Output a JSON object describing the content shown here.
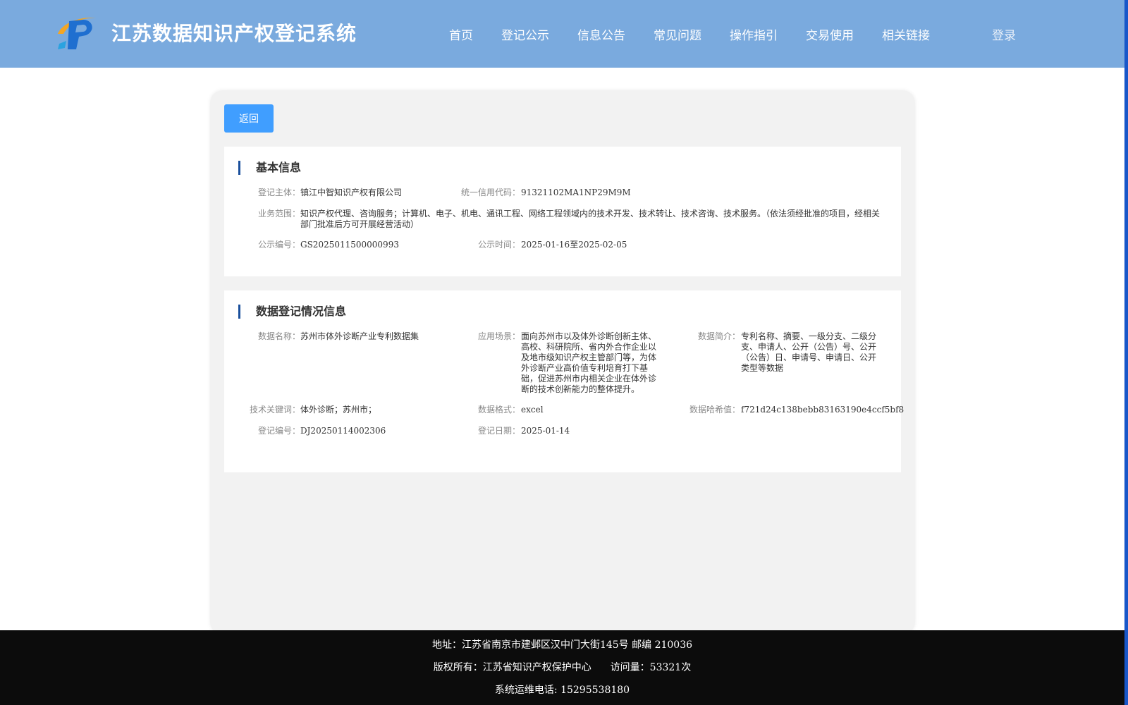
{
  "header": {
    "title": "江苏数据知识产权登记系统",
    "nav": [
      "首页",
      "登记公示",
      "信息公告",
      "常见问题",
      "操作指引",
      "交易使用",
      "相关链接"
    ],
    "login": "登录"
  },
  "back_button": "返回",
  "basic_info": {
    "title": "基本信息",
    "subject_label": "登记主体：",
    "subject": "镇江中智知识产权有限公司",
    "credit_code_label": "统一信用代码：",
    "credit_code": "91321102MA1NP29M9M",
    "business_scope_label": "业务范围：",
    "business_scope": "知识产权代理、咨询服务；计算机、电子、机电、通讯工程、网络工程领域内的技术开发、技术转让、技术咨询、技术服务。（依法须经批准的项目，经相关部门批准后方可开展经营活动）",
    "notice_no_label": "公示编号：",
    "notice_no": "GS2025011500000993",
    "notice_time_label": "公示时间：",
    "notice_time": "2025-01-16至2025-02-05"
  },
  "data_info": {
    "title": "数据登记情况信息",
    "name_label": "数据名称：",
    "name": "苏州市体外诊断产业专利数据集",
    "scenario_label": "应用场景：",
    "scenario": "面向苏州市以及体外诊断创新主体、高校、科研院所、省内外合作企业以及地市级知识产权主管部门等，为体外诊断产业高价值专利培育打下基础，促进苏州市内相关企业在体外诊断的技术创新能力的整体提升。",
    "summary_label": "数据简介：",
    "summary": "专利名称、摘要、一级分支、二级分支、申请人、公开（公告）号、公开（公告）日、申请号、申请日、公开类型等数据",
    "keywords_label": "技术关键词：",
    "keywords": "体外诊断；苏州市；",
    "format_label": "数据格式：",
    "format": "excel",
    "hash_label": "数据哈希值：",
    "hash": "f721d24c138bebb83163190e4ccf5bf8",
    "reg_no_label": "登记编号：",
    "reg_no": "DJ20250114002306",
    "reg_date_label": "登记日期：",
    "reg_date": "2025-01-14"
  },
  "footer": {
    "address": "地址：江苏省南京市建邺区汉中门大街145号 邮编 210036",
    "copyright": "版权所有：江苏省知识产权保护中心",
    "visits": "访问量：53321次",
    "phone": "系统运维电话: 15295538180"
  },
  "colors": {
    "header_bg": "#7aaade",
    "button_blue": "#409eff",
    "title_bar": "#1a4f9c",
    "footer_bg": "#0c0c0c"
  }
}
